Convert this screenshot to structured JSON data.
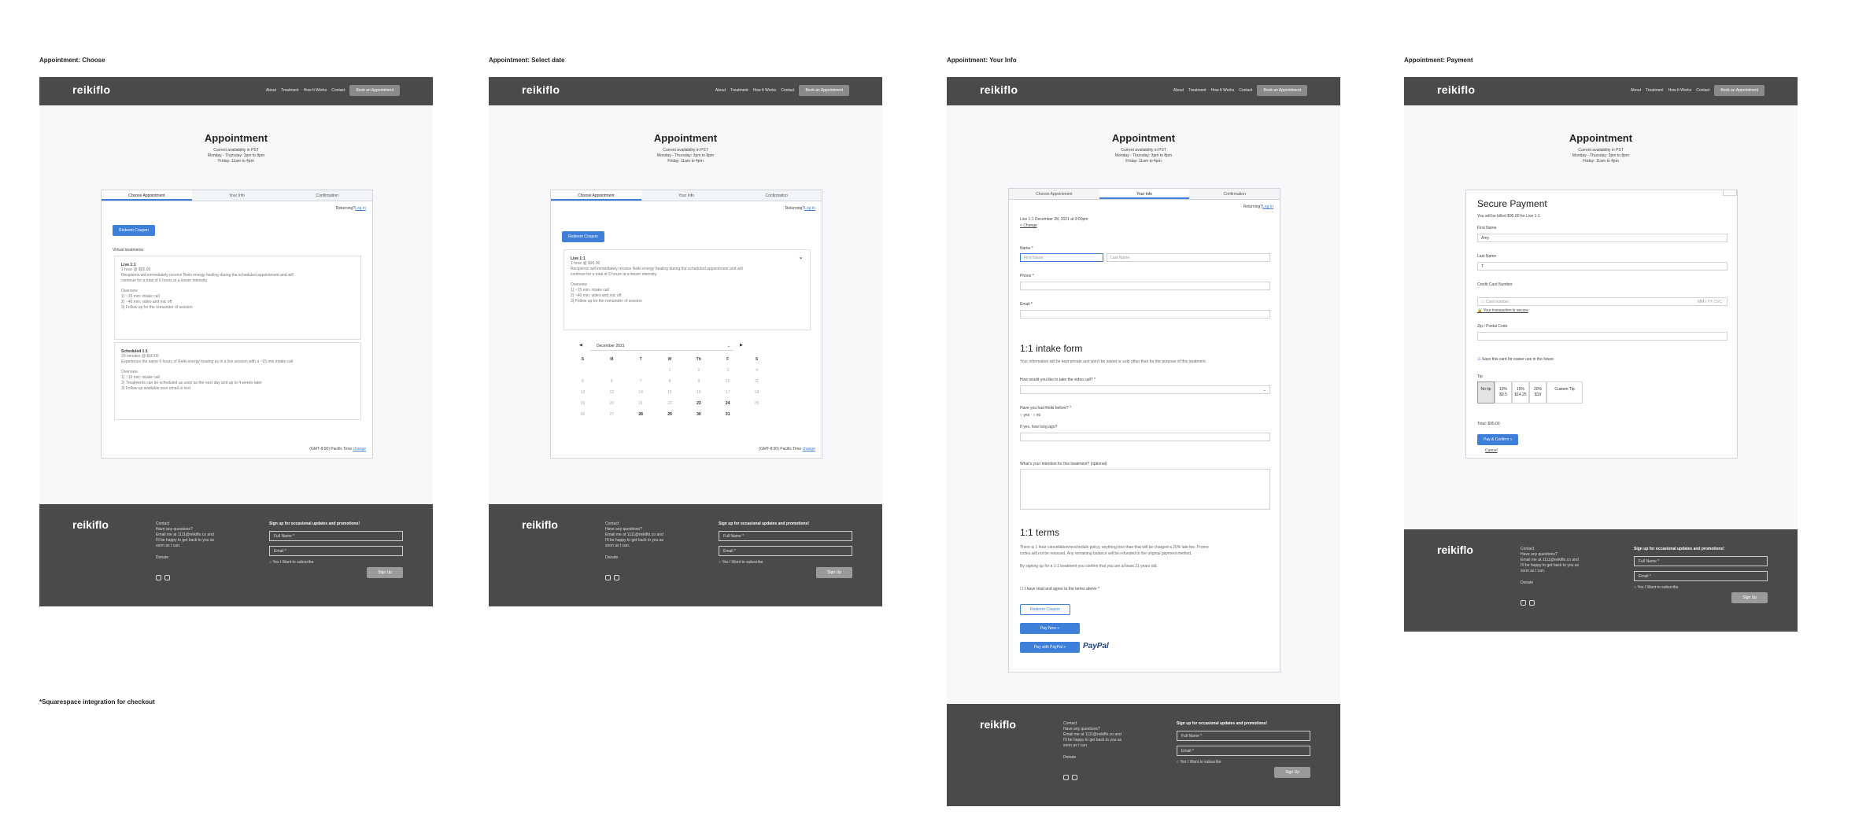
{
  "frames": [
    {
      "label": "Appointment: Choose"
    },
    {
      "label": "Appointment: Select date"
    },
    {
      "label": "Appointment: Your Info"
    },
    {
      "label": "Appointment: Payment"
    }
  ],
  "footnote": "*Squarespace integration for checkout",
  "nav": {
    "logo": "reikiflo",
    "links": [
      "About",
      "Treatment",
      "How It Works",
      "Contact"
    ],
    "cta": "Book an Appointment"
  },
  "header": {
    "title": "Appointment",
    "availability": [
      "Current availability in PST",
      "Monday - Thursday: 3pm to 8pm",
      "Friday: 11am to 4pm"
    ]
  },
  "tabs": [
    "Choose Appointment",
    "Your Info",
    "Confirmation"
  ],
  "returning": {
    "text": "Returning?",
    "link": "Log In"
  },
  "coupon_label": "Redeem Coupon",
  "virtual_label": "Virtual treatments",
  "treatments": [
    {
      "name": "Live 1:1",
      "price": "1 hour @ $95.00",
      "desc1": "Recipients will immediately receive Reiki energy healing during the scheduled appointment and will",
      "desc2": "continue for a total of 6 hours at a lesser intensity.",
      "overview": "Overview",
      "steps": [
        "1) ~15 min: intake call",
        "2) ~40 min: video and mic off",
        "3) Follow up for the remainder of session"
      ]
    },
    {
      "name": "Scheduled 1:1",
      "price": "20 minutes @ $60.00",
      "desc1": "Experience the same 6 hours of Reiki energy healing as in a live session with a ~15 min intake call.",
      "desc2": "",
      "overview": "Overview",
      "steps": [
        "1) ~15 min: intake call",
        "2) Treatments can be scheduled as soon as the next day and up to 4 weeks later",
        "3) Follow up available over email or text"
      ]
    }
  ],
  "timezone": {
    "text": "(GMT-8:00) Pacific Time",
    "link": "change"
  },
  "calendar": {
    "month": "December 2021",
    "dow": [
      "S",
      "M",
      "T",
      "W",
      "Th",
      "F",
      "S"
    ],
    "days": [
      "",
      "",
      "",
      "1",
      "2",
      "3",
      "4",
      "5",
      "6",
      "7",
      "8",
      "9",
      "10",
      "11",
      "12",
      "13",
      "14",
      "15",
      "16",
      "17",
      "18",
      "19",
      "20",
      "21",
      "22",
      "23",
      "24",
      "25",
      "26",
      "27",
      "28",
      "29",
      "30",
      "31",
      ""
    ],
    "available": [
      "23",
      "24",
      "28",
      "29",
      "30",
      "31"
    ]
  },
  "info": {
    "summary": "Live 1:1 December 28, 2021 at 3:00pm",
    "change": "< Change",
    "name_label": "Name *",
    "first_placeholder": "First Name",
    "last_placeholder": "Last Name",
    "phone_label": "Phone *",
    "email_label": "Email *",
    "intake_title": "1:1 intake form",
    "intake_note": "Your information will be kept private and won't be saved or sold other than for the purpose of this treatment.",
    "q1": "How would you like to take the video call? *",
    "q2": "Have you had Reiki before? *",
    "yes": "yes",
    "no": "no",
    "q3": "If yes, how long ago?",
    "q4": "What's your intention for this treatment? (optional)",
    "terms_title": "1:1 terms",
    "terms1": "There is 1 hour cancellation/reschedule policy, anything less than that will be charged a 20% late fee. Promo",
    "terms2": "codes will not be reissued. Any remaining balance will be refunded to the original payment method.",
    "terms3": "By signing up for a 1:1 treatment you confirm that you are at least 21 years old.",
    "agree": "I have read and agree to the terms above *",
    "pay_now": "Pay Now »",
    "pay_paypal": "Pay with PayPal »",
    "paypal": "PayPal"
  },
  "payment": {
    "title": "Secure Payment",
    "billed": "You will be billed $95.00 for Live 1:1",
    "first_label": "First Name",
    "first_value": "Amy",
    "last_label": "Last Name",
    "last_value": "T",
    "card_label": "Credit Card Number",
    "card_placeholder": "Card number",
    "card_meta": "MM / YY  CVC",
    "secure_link": "Your transaction is secure",
    "zip_label": "Zip / Postal Code",
    "save_card": "Save this card for easier use in the future",
    "tip_label": "Tip",
    "tips": [
      {
        "label": "No tip",
        "sub": ""
      },
      {
        "label": "10%",
        "sub": "$9.5"
      },
      {
        "label": "15%",
        "sub": "$14.25"
      },
      {
        "label": "20%",
        "sub": "$19"
      }
    ],
    "custom_tip": "Custom Tip",
    "total": "Total: $95.00",
    "confirm": "Pay & Confirm »",
    "cancel": "Cancel"
  },
  "footer": {
    "logo": "reikiflo",
    "contact_title": "Contact",
    "contact_lines": [
      "Have any questions?",
      "Email me at 1111@reikiflo.co and",
      "I'll be happy to get back to you as",
      "soon as I can."
    ],
    "donate": "Donate",
    "signup_title": "Sign up for occasional updates and promotions!",
    "full_name": "Full Name *",
    "email": "Email *",
    "subscribe": "Yes I Want to subscribe",
    "signup_btn": "Sign Up"
  }
}
